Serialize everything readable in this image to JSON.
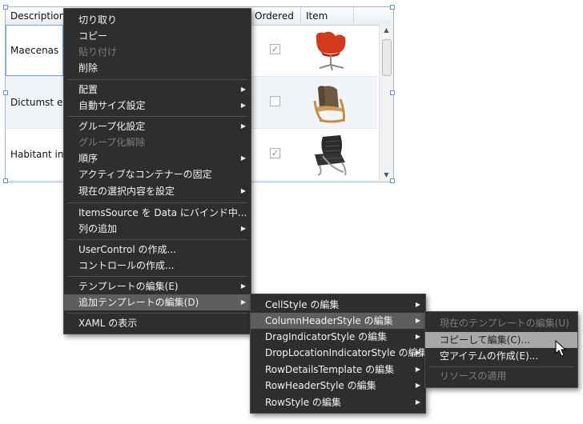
{
  "grid": {
    "columns": [
      "Description",
      "Ordered",
      "Item"
    ],
    "rows": [
      {
        "description": "Maecenas p",
        "ordered": true,
        "item_icon": "swan-chair-icon"
      },
      {
        "description": "Dictumst ele",
        "ordered": false,
        "item_icon": "armchair-icon"
      },
      {
        "description": "Habitant inc",
        "ordered": true,
        "item_icon": "barcelona-chair-icon"
      }
    ]
  },
  "context_menu": {
    "items": [
      {
        "label": "切り取り",
        "enabled": true,
        "submenu": false
      },
      {
        "label": "コピー",
        "enabled": true,
        "submenu": false
      },
      {
        "label": "貼り付け",
        "enabled": false,
        "submenu": false
      },
      {
        "label": "削除",
        "enabled": true,
        "submenu": false
      },
      {
        "label": "配置",
        "enabled": true,
        "submenu": true
      },
      {
        "label": "自動サイズ設定",
        "enabled": true,
        "submenu": true
      },
      {
        "label": "グループ化設定",
        "enabled": true,
        "submenu": true
      },
      {
        "label": "グループ化解除",
        "enabled": false,
        "submenu": false
      },
      {
        "label": "順序",
        "enabled": true,
        "submenu": true
      },
      {
        "label": "アクティブなコンテナーの固定",
        "enabled": true,
        "submenu": false
      },
      {
        "label": "現在の選択内容を設定",
        "enabled": true,
        "submenu": true
      },
      {
        "label": "ItemsSource を Data にバインド中...",
        "enabled": true,
        "submenu": false
      },
      {
        "label": "列の追加",
        "enabled": true,
        "submenu": true
      },
      {
        "label": "UserControl の作成...",
        "enabled": true,
        "submenu": false
      },
      {
        "label": "コントロールの作成...",
        "enabled": true,
        "submenu": false
      },
      {
        "label": "テンプレートの編集(E)",
        "enabled": true,
        "submenu": true
      },
      {
        "label": "追加テンプレートの編集(D)",
        "enabled": true,
        "submenu": true,
        "highlighted": true
      },
      {
        "label": "XAML の表示",
        "enabled": true,
        "submenu": false
      }
    ]
  },
  "templates_submenu": {
    "items": [
      {
        "label": "CellStyle の編集"
      },
      {
        "label": "ColumnHeaderStyle の編集",
        "highlighted": true
      },
      {
        "label": "DragIndicatorStyle の編集"
      },
      {
        "label": "DropLocationIndicatorStyle の編集"
      },
      {
        "label": "RowDetailsTemplate の編集"
      },
      {
        "label": "RowHeaderStyle の編集"
      },
      {
        "label": "RowStyle の編集"
      }
    ]
  },
  "style_submenu": {
    "items": [
      {
        "label": "現在のテンプレートの編集(U)",
        "enabled": false
      },
      {
        "label": "コピーして編集(C)...",
        "enabled": true,
        "highlighted": true
      },
      {
        "label": "空アイテムの作成(E)...",
        "enabled": true
      },
      {
        "label": "リソースの適用",
        "enabled": false
      }
    ]
  },
  "colors": {
    "menu_bg": "#2e2e2e",
    "menu_highlight": "#5e5e5e",
    "menu_highlight_light": "#a8a8a8",
    "grid_border": "#9fb6d0"
  }
}
